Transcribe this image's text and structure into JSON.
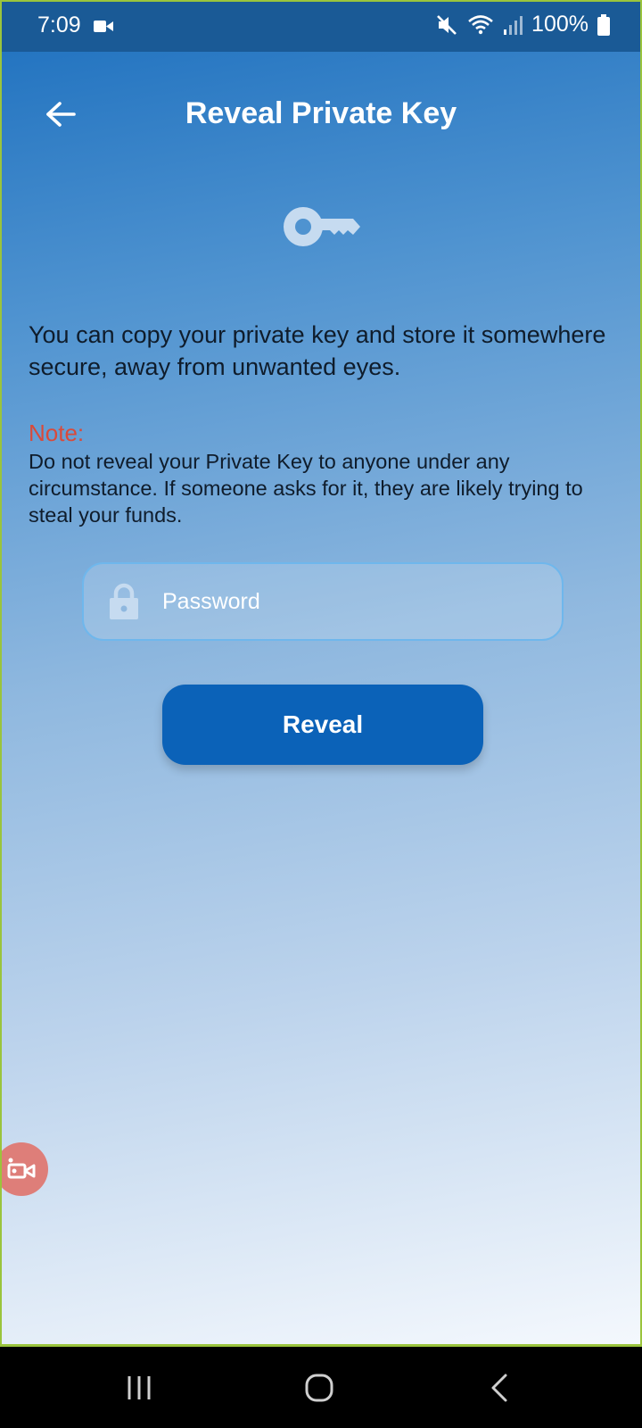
{
  "status_bar": {
    "time": "7:09",
    "battery": "100%",
    "icons": [
      "video-camera-icon",
      "mute-icon",
      "wifi-icon",
      "signal-icon",
      "battery-icon"
    ]
  },
  "header": {
    "title": "Reveal Private Key",
    "back_icon": "arrow-left-icon"
  },
  "main": {
    "hero_icon": "key-icon",
    "intro": "You can copy your private key and store it somewhere secure, away from unwanted eyes.",
    "note_label": "Note:",
    "note_text": "Do not reveal your Private Key to anyone under any circumstance. If someone asks for it, they are likely trying to steal your funds.",
    "password": {
      "placeholder": "Password",
      "value": "",
      "icon": "lock-icon"
    },
    "reveal_label": "Reveal"
  },
  "overlay": {
    "recorder_icon": "screen-recorder-icon"
  },
  "nav_bar": {
    "icons": [
      "recents-icon",
      "home-icon",
      "back-icon"
    ]
  },
  "colors": {
    "gradient_top": "#1c6fbe",
    "gradient_bottom": "#f4f8fd",
    "note_red": "#d94a3a",
    "button_blue": "#0b62b8",
    "field_border": "#6fb7ec"
  }
}
